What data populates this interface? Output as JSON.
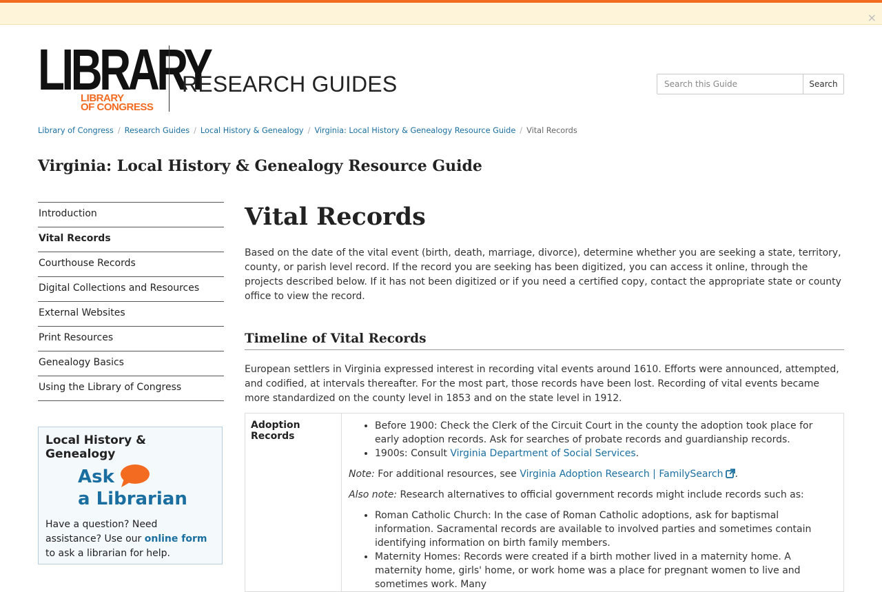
{
  "alert": {
    "close_label": "×"
  },
  "logo": {
    "word": "LIBRARY",
    "sub_line1": "LIBRARY",
    "sub_line2": "OF CONGRESS"
  },
  "site_title": "RESEARCH GUIDES",
  "search": {
    "placeholder": "Search this Guide",
    "button_label": "Search"
  },
  "breadcrumb": {
    "items": [
      "Library of Congress",
      "Research Guides",
      "Local History & Genealogy",
      "Virginia: Local History & Genealogy Resource Guide"
    ],
    "current": "Vital Records",
    "separator": "/"
  },
  "guide_title": "Virginia: Local History & Genealogy Resource Guide",
  "sidenav": {
    "items": [
      "Introduction",
      "Vital Records",
      "Courthouse Records",
      "Digital Collections and Resources",
      "External Websites",
      "Print Resources",
      "Genealogy Basics",
      "Using the Library of Congress"
    ],
    "active": "Vital Records"
  },
  "askbox": {
    "title": "Local History & Genealogy",
    "logo_line1": "Ask",
    "logo_line2": "a Librarian",
    "text_before": "Have a question? Need assistance? Use our ",
    "link": "online form",
    "text_after": " to ask a librarian for help."
  },
  "main": {
    "heading": "Vital Records",
    "intro": "Based on the date of the vital event (birth, death, marriage, divorce), determine whether you are seeking a state, territory, county, or parish level record. If the record you are seeking has been digitized, you can access it online, through the projects described below. If it has not been digitized or if you need a certified copy, contact the appropriate state or county office to view the record.",
    "section_heading": "Timeline of Vital Records",
    "section_para": "European settlers in Virginia expressed interest in recording vital events around 1610. Efforts were announced, attempted, and codified, at intervals thereafter. For the most part, those records have been lost. Recording of vital events became more standardized on the county level in 1853 and on the state level in 1912.",
    "table": {
      "row_label": "Adoption Records",
      "list1": [
        {
          "text": "Before 1900: Check the Clerk of the Circuit Court in the county the adoption took place for early adoption records. Ask for searches of probate records and guardianship records."
        },
        {
          "text": "1900s: Consult ",
          "link": "Virginia Department of Social Services",
          "after": "."
        }
      ],
      "note_label": "Note:",
      "note_text": " For additional resources, see ",
      "note_link": "Virginia Adoption Research | FamilySearch",
      "note_after": ".",
      "also_label": "Also note:",
      "also_text": " Research alternatives to official government records might include records such as:",
      "list2": [
        "Roman Catholic Church: In the case of Roman Catholic adoptions, ask for baptismal information. Sacramental records are available to involved parties and sometimes contain identifying information on birth family members.",
        "Maternity Homes: Records were created if a birth mother lived in a maternity home. A maternity home, girls' home, or work home was a place for pregnant women to live and sometimes work. Many"
      ]
    }
  },
  "colors": {
    "accent": "#f26b21",
    "link": "#1a6fa0",
    "alert_bg": "#fdf4da"
  },
  "icons": [
    "close-icon",
    "external-link-icon",
    "speech-bubble-icon"
  ]
}
